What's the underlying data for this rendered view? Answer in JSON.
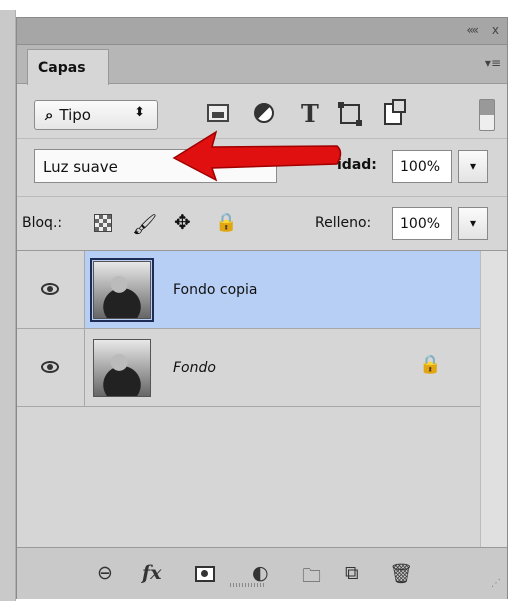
{
  "window": {
    "collapse_glyph": "««",
    "close_glyph": "x",
    "menu_glyph": "▾≡"
  },
  "tab": {
    "label": "Capas"
  },
  "filter": {
    "kind_label": "Tipo",
    "search_glyph": "⌕",
    "updown_glyph": "⬍",
    "type_glyph": "T"
  },
  "blend": {
    "mode": "Luz suave",
    "opacity_label": "idad:",
    "opacity_value": "100%",
    "dropdown_glyph": "▾"
  },
  "lock": {
    "label": "Bloq.:",
    "brush_glyph": "🖌",
    "move_glyph": "✥",
    "lock_glyph": "🔒",
    "fill_label": "Relleno:",
    "fill_value": "100%"
  },
  "layers": [
    {
      "name": "Fondo copia",
      "selected": true,
      "italic": false,
      "locked": false
    },
    {
      "name": "Fondo",
      "selected": false,
      "italic": true,
      "locked": true
    }
  ],
  "bottom": {
    "link_glyph": "⊖",
    "fx_label": "fx",
    "adjust_glyph": "◐",
    "folder_glyph": "🗀",
    "new_glyph": "⧉",
    "trash_glyph": "🗑",
    "grip_glyph": "⋰"
  },
  "colors": {
    "panel_bg": "#d6d6d6",
    "selected_layer": "#b8cff5",
    "arrow": "#e01010"
  }
}
